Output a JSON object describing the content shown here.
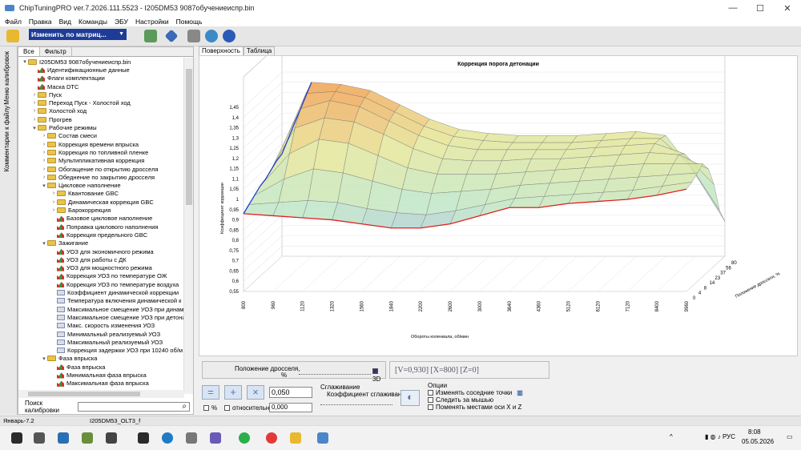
{
  "window": {
    "title": "ChipTuningPRO ver.7.2026.111.5523 - I205DM53 9087обучениеиспр.bin",
    "min": "—",
    "max": "☐",
    "close": "✕"
  },
  "menu": [
    "Файл",
    "Правка",
    "Вид",
    "Команды",
    "ЭБУ",
    "Настройки",
    "Помощь"
  ],
  "toolbar": {
    "mode_dropdown": "Изменить по матриц...",
    "caret": "▼"
  },
  "sidebar_vtabs": [
    "Меню калибровок",
    "Комментарии к файлу"
  ],
  "left_tabs": [
    "Все",
    "Фильтр"
  ],
  "tree": [
    {
      "l": 0,
      "t": "root",
      "s": "▾",
      "n": "I205DM53 9087обучениеиспр.bin"
    },
    {
      "l": 1,
      "t": "chart",
      "s": "",
      "n": "Идентификационные данные"
    },
    {
      "l": 1,
      "t": "chart",
      "s": "",
      "n": "Флаги комплектации"
    },
    {
      "l": 1,
      "t": "chart",
      "s": "",
      "n": "Маска DTC"
    },
    {
      "l": 1,
      "t": "folder",
      "s": "›",
      "n": "Пуск"
    },
    {
      "l": 1,
      "t": "folder",
      "s": "›",
      "n": "Переход Пуск - Холостой ход"
    },
    {
      "l": 1,
      "t": "folder",
      "s": "›",
      "n": "Холостой ход"
    },
    {
      "l": 1,
      "t": "folder",
      "s": "›",
      "n": "Прогрев"
    },
    {
      "l": 1,
      "t": "folder",
      "s": "▾",
      "n": "Рабочие режимы"
    },
    {
      "l": 2,
      "t": "folder",
      "s": "›",
      "n": "Состав смеси"
    },
    {
      "l": 2,
      "t": "folder",
      "s": "›",
      "n": "Коррекция времени впрыска"
    },
    {
      "l": 2,
      "t": "folder",
      "s": "›",
      "n": "Коррекция по топливной пленке"
    },
    {
      "l": 2,
      "t": "folder",
      "s": "›",
      "n": "Мультипликативная коррекция"
    },
    {
      "l": 2,
      "t": "folder",
      "s": "›",
      "n": "Обогащение по открытию дросселя"
    },
    {
      "l": 2,
      "t": "folder",
      "s": "›",
      "n": "Обеднение по закрытию дросселя"
    },
    {
      "l": 2,
      "t": "folder",
      "s": "▾",
      "n": "Цикловое наполнение"
    },
    {
      "l": 3,
      "t": "folder",
      "s": "›",
      "n": "Квантование GBC"
    },
    {
      "l": 3,
      "t": "folder",
      "s": "›",
      "n": "Динамическая коррекция GBC"
    },
    {
      "l": 3,
      "t": "folder",
      "s": "›",
      "n": "Барокоррекция"
    },
    {
      "l": 3,
      "t": "chart",
      "s": "",
      "n": "Базовое цикловое наполнение"
    },
    {
      "l": 3,
      "t": "chart",
      "s": "",
      "n": "Поправка циклового наполнения"
    },
    {
      "l": 3,
      "t": "chart",
      "s": "",
      "n": "Коррекция предельного GBC"
    },
    {
      "l": 2,
      "t": "folder",
      "s": "▾",
      "n": "Зажигание"
    },
    {
      "l": 3,
      "t": "chart",
      "s": "",
      "n": "УОЗ для экономичного режима"
    },
    {
      "l": 3,
      "t": "chart",
      "s": "",
      "n": "УОЗ для работы с ДК"
    },
    {
      "l": 3,
      "t": "chart",
      "s": "",
      "n": "УОЗ для мощностного режима"
    },
    {
      "l": 3,
      "t": "chart",
      "s": "",
      "n": "Коррекция УОЗ по температуре ОЖ"
    },
    {
      "l": 3,
      "t": "chart",
      "s": "",
      "n": "Коррекция УОЗ по температуре воздуха"
    },
    {
      "l": 3,
      "t": "val",
      "s": "",
      "n": "Коэффициент динамической коррекции"
    },
    {
      "l": 3,
      "t": "val",
      "s": "",
      "n": "Температура включения динамической к"
    },
    {
      "l": 3,
      "t": "val",
      "s": "",
      "n": "Максимальное смещение УОЗ при динам"
    },
    {
      "l": 3,
      "t": "val",
      "s": "",
      "n": "Максимальное смещение УОЗ при детона"
    },
    {
      "l": 3,
      "t": "val",
      "s": "",
      "n": "Макс. скорость изменения УОЗ"
    },
    {
      "l": 3,
      "t": "val",
      "s": "",
      "n": "Минимальный реализуемый УОЗ"
    },
    {
      "l": 3,
      "t": "val",
      "s": "",
      "n": "Максимальный реализуемый УОЗ"
    },
    {
      "l": 3,
      "t": "val",
      "s": "",
      "n": "Коррекция задержки УОЗ при 10240 об/м"
    },
    {
      "l": 2,
      "t": "folder",
      "s": "▾",
      "n": "Фаза впрыска"
    },
    {
      "l": 3,
      "t": "chart",
      "s": "",
      "n": "Фаза впрыска"
    },
    {
      "l": 3,
      "t": "chart",
      "s": "",
      "n": "Минимальная фаза впрыска"
    },
    {
      "l": 3,
      "t": "chart",
      "s": "",
      "n": "Максимальная фаза впрыска"
    }
  ],
  "search": {
    "label": "Поиск калибровки",
    "value": ""
  },
  "right_tabs": [
    "Поверхность",
    "Таблица"
  ],
  "chart_data": {
    "type": "surface3d",
    "title": "Коррекция порога детонации",
    "xlabel": "Обороты коленвала, об/мин",
    "ylabel": "Коэффициент коррекции",
    "zlabel": "Положение дросселя, %",
    "x_ticks": [
      "800",
      "960",
      "1120",
      "1320",
      "1560",
      "1840",
      "2200",
      "2600",
      "3000",
      "3640",
      "4360",
      "5120",
      "6120",
      "7120",
      "8400",
      "9960"
    ],
    "y_ticks": [
      "0,55",
      "0,6",
      "0,65",
      "0,7",
      "0,75",
      "0,8",
      "0,85",
      "0,9",
      "0,95",
      "1",
      "1,05",
      "1,1",
      "1,15",
      "1,2",
      "1,25",
      "1,3",
      "1,35",
      "1,4",
      "1,45"
    ],
    "z_ticks": [
      "0",
      "4",
      "8",
      "14",
      "23",
      "37",
      "56",
      "80"
    ],
    "ylim": [
      0.55,
      1.45
    ],
    "surface": [
      [
        0.93,
        0.92,
        0.91,
        0.9,
        0.88,
        0.86,
        0.86,
        0.88,
        0.92,
        0.96,
        0.96,
        0.98,
        0.99,
        1.0,
        1.02,
        1.05
      ],
      [
        0.95,
        0.96,
        0.97,
        0.96,
        0.93,
        0.91,
        0.9,
        0.92,
        0.95,
        0.98,
        0.99,
        1.0,
        1.01,
        1.02,
        1.04,
        1.06
      ],
      [
        0.97,
        1.05,
        1.1,
        1.08,
        1.04,
        1.0,
        0.98,
        0.99,
        1.0,
        1.02,
        1.03,
        1.04,
        1.05,
        1.06,
        1.07,
        1.08
      ],
      [
        0.99,
        1.15,
        1.22,
        1.2,
        1.14,
        1.08,
        1.05,
        1.05,
        1.05,
        1.06,
        1.07,
        1.08,
        1.09,
        1.1,
        1.1,
        1.1
      ],
      [
        1.0,
        1.25,
        1.3,
        1.28,
        1.22,
        1.15,
        1.1,
        1.09,
        1.09,
        1.1,
        1.1,
        1.11,
        1.12,
        1.13,
        1.12,
        1.05
      ],
      [
        1.02,
        1.32,
        1.36,
        1.33,
        1.26,
        1.19,
        1.14,
        1.12,
        1.12,
        1.12,
        1.12,
        1.13,
        1.14,
        1.15,
        1.1,
        0.95
      ],
      [
        1.04,
        1.37,
        1.38,
        1.35,
        1.28,
        1.21,
        1.16,
        1.14,
        1.13,
        1.13,
        1.13,
        1.14,
        1.15,
        1.15,
        1.02,
        0.8
      ],
      [
        1.05,
        1.4,
        1.39,
        1.36,
        1.29,
        1.22,
        1.17,
        1.15,
        1.14,
        1.14,
        1.14,
        1.15,
        1.16,
        1.14,
        0.95,
        0.72
      ]
    ]
  },
  "bottom": {
    "throttle_label": "Положение дросселя,",
    "pct": "%",
    "cb3d": "3D",
    "coords": "[V=0,930] [X=800] [Z=0]",
    "step": "0,050",
    "step2": "0,000",
    "cb_pct": "%",
    "cb_rel": "относительно",
    "smooth_title": "Сглаживание",
    "smooth_label": "Коэффициент сглаживания",
    "options_title": "Опции",
    "options": [
      "Изменять соседние точки",
      "Следить за мышью",
      "Поменять местами оси X и Z"
    ]
  },
  "status": {
    "left": "Январь-7.2",
    "right": "I205DM53_OLT3_f"
  },
  "tray": {
    "lang": "РУС",
    "time": "8:08",
    "date": "05.05.2026"
  }
}
